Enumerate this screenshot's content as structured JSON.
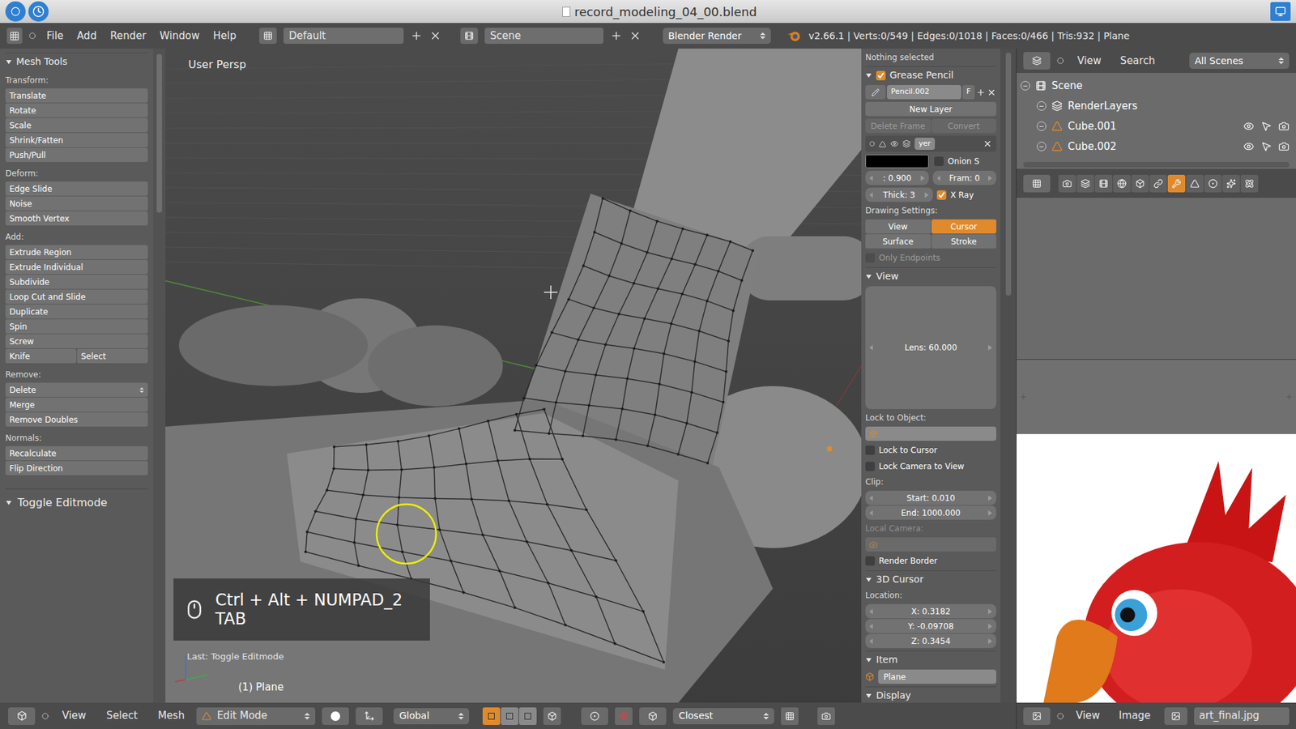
{
  "window": {
    "title": "record_modeling_04_00.blend"
  },
  "info_header": {
    "menus": [
      "File",
      "Add",
      "Render",
      "Window",
      "Help"
    ],
    "layout": "Default",
    "scene": "Scene",
    "engine": "Blender Render",
    "stats": "v2.66.1 | Verts:0/549 | Edges:0/1018 | Faces:0/466 | Tris:932 | Plane"
  },
  "tool_shelf": {
    "title": "Mesh Tools",
    "expanded": true,
    "sections": [
      {
        "label": "Transform:",
        "rows": [
          [
            {
              "label": "Translate",
              "kind": "button"
            }
          ],
          [
            {
              "label": "Rotate",
              "kind": "button"
            }
          ],
          [
            {
              "label": "Scale",
              "kind": "button"
            }
          ],
          [
            {
              "label": "Shrink/Fatten",
              "kind": "button"
            }
          ],
          [
            {
              "label": "Push/Pull",
              "kind": "button"
            }
          ]
        ]
      },
      {
        "label": "Deform:",
        "rows": [
          [
            {
              "label": "Edge Slide",
              "kind": "button"
            }
          ],
          [
            {
              "label": "Noise",
              "kind": "button"
            }
          ],
          [
            {
              "label": "Smooth Vertex",
              "kind": "button"
            }
          ]
        ]
      },
      {
        "label": "Add:",
        "rows": [
          [
            {
              "label": "Extrude Region",
              "kind": "button"
            }
          ],
          [
            {
              "label": "Extrude Individual",
              "kind": "button"
            }
          ],
          [
            {
              "label": "Subdivide",
              "kind": "button"
            }
          ],
          [
            {
              "label": "Loop Cut and Slide",
              "kind": "button"
            }
          ],
          [
            {
              "label": "Duplicate",
              "kind": "button"
            }
          ],
          [
            {
              "label": "Spin",
              "kind": "button"
            }
          ],
          [
            {
              "label": "Screw",
              "kind": "button"
            }
          ],
          [
            {
              "label": "Knife",
              "kind": "button"
            },
            {
              "label": "Select",
              "kind": "button"
            }
          ]
        ]
      },
      {
        "label": "Remove:",
        "rows": [
          [
            {
              "label": "Delete",
              "kind": "dropdown"
            }
          ],
          [
            {
              "label": "Merge",
              "kind": "button"
            }
          ],
          [
            {
              "label": "Remove Doubles",
              "kind": "button"
            }
          ]
        ]
      },
      {
        "label": "Normals:",
        "rows": [
          [
            {
              "label": "Recalculate",
              "kind": "button"
            }
          ],
          [
            {
              "label": "Flip Direction",
              "kind": "button"
            }
          ]
        ]
      }
    ]
  },
  "operator_panel": {
    "title": "Toggle Editmode",
    "expanded": true
  },
  "viewport": {
    "view_name": "User Persp",
    "keys": [
      "Ctrl + Alt + NUMPAD_2",
      "TAB"
    ],
    "last_op": "Last: Toggle Editmode",
    "object": "(1) Plane"
  },
  "n_panel": {
    "status": "Nothing selected",
    "grease_pencil": {
      "title": "Grease Pencil",
      "expanded": true,
      "enabled": true,
      "pencil": "Pencil.002",
      "fake_user": "F",
      "new_layer": "New Layer",
      "delete_frame": "Delete Frame",
      "convert": "Convert",
      "actions_disabled": true,
      "layer_name": "yer",
      "color": "#000000",
      "opacity": ": 0.900",
      "onion": {
        "label": "Onion S",
        "checked": false
      },
      "frame": "Fram: 0",
      "thickness": "Thick: 3",
      "xray": {
        "label": "X Ray",
        "checked": true
      },
      "drawing_settings": "Drawing Settings:",
      "modes": [
        {
          "label": "View",
          "selected": false
        },
        {
          "label": "Cursor",
          "selected": true
        },
        {
          "label": "Surface",
          "selected": false
        },
        {
          "label": "Stroke",
          "selected": false
        }
      ],
      "only_endpoints": {
        "label": "Only Endpoints",
        "checked": false,
        "disabled": true
      }
    },
    "view": {
      "title": "View",
      "expanded": true,
      "lens": "Lens: 60.000",
      "lock_to_object": "Lock to Object:",
      "lock_to_cursor": {
        "label": "Lock to Cursor",
        "checked": false
      },
      "lock_camera": {
        "label": "Lock Camera to View",
        "checked": false
      },
      "clip": "Clip:",
      "clip_start": "Start: 0.010",
      "clip_end": "End: 1000.000",
      "local_camera": "Local Camera:",
      "local_camera_disabled": true,
      "render_border": {
        "label": "Render Border",
        "checked": false
      }
    },
    "cursor": {
      "title": "3D Cursor",
      "expanded": true,
      "location": "Location:",
      "coords": [
        "X: 0.3182",
        "Y: -0.09708",
        "Z: 0.3454"
      ]
    },
    "item": {
      "title": "Item",
      "expanded": true,
      "name": "Plane"
    },
    "display": {
      "title": "Display",
      "expanded": true
    }
  },
  "outliner": {
    "menus": [
      "View",
      "Search"
    ],
    "filter": "All Scenes",
    "tree": [
      {
        "label": "Scene",
        "depth": 0,
        "kind": "scene",
        "expanded": true
      },
      {
        "label": "RenderLayers",
        "depth": 1,
        "kind": "renderlayers",
        "expanded": false
      },
      {
        "label": "Cube.001",
        "depth": 1,
        "kind": "object",
        "expanded": false
      },
      {
        "label": "Cube.002",
        "depth": 1,
        "kind": "object",
        "expanded": false
      }
    ]
  },
  "properties": {
    "tabs": [
      {
        "kind": "render",
        "selected": false
      },
      {
        "kind": "layers",
        "selected": false
      },
      {
        "kind": "scene",
        "selected": false
      },
      {
        "kind": "world",
        "selected": false
      },
      {
        "kind": "object",
        "selected": false
      },
      {
        "kind": "constraints",
        "selected": false
      },
      {
        "kind": "modifiers",
        "selected": true
      },
      {
        "kind": "data",
        "selected": false
      },
      {
        "kind": "material",
        "selected": false
      },
      {
        "kind": "particles",
        "selected": false
      },
      {
        "kind": "physics",
        "selected": false
      }
    ]
  },
  "image_editor": {
    "menus": [
      "View",
      "Image"
    ],
    "image": "art_final.jpg"
  },
  "view3d_header": {
    "menus": [
      "View",
      "Select",
      "Mesh"
    ],
    "mode": "Edit Mode",
    "orientation": "Global",
    "select_modes": [
      {
        "kind": "vertex",
        "selected": true
      },
      {
        "kind": "edge",
        "selected": false
      },
      {
        "kind": "face",
        "selected": false
      }
    ],
    "snap": "Closest"
  }
}
